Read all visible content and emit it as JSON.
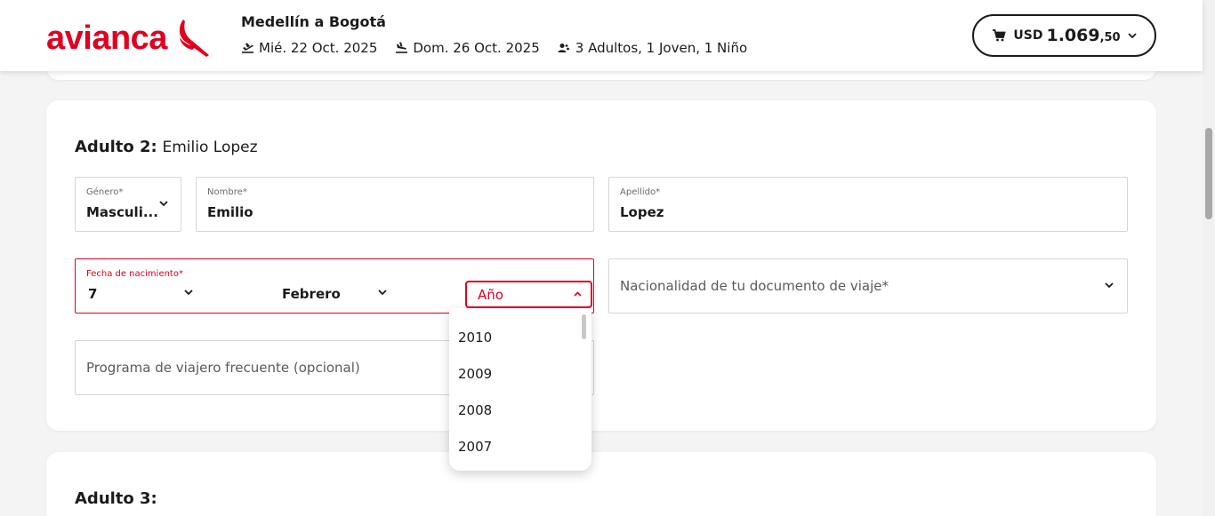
{
  "header": {
    "logo_text": "avianca",
    "route": "Medellín a Bogotá",
    "departure_date": "Mié. 22 Oct. 2025",
    "return_date": "Dom. 26 Oct. 2025",
    "passengers": "3 Adultos, 1 Joven, 1 Niño",
    "cart": {
      "currency": "USD",
      "amount": "1.069",
      "cents": ",50"
    }
  },
  "passenger2": {
    "title": "Adulto 2:",
    "name": "Emilio Lopez",
    "gender": {
      "label": "Género*",
      "value": "Masculi..."
    },
    "first_name": {
      "label": "Nombre*",
      "value": "Emilio"
    },
    "last_name": {
      "label": "Apellido*",
      "value": "Lopez"
    },
    "dob": {
      "label": "Fecha de nacimiento*",
      "day": "7",
      "month": "Febrero",
      "year_placeholder": "Año",
      "year_options": [
        "2010",
        "2009",
        "2008",
        "2007"
      ]
    },
    "nationality_placeholder": "Nacionalidad de tu documento de viaje*",
    "frequent_flyer_placeholder": "Programa de viajero frecuente (opcional)"
  },
  "passenger3": {
    "title": "Adulto 3:"
  },
  "colors": {
    "brand_red": "#e1001f",
    "text": "#1b1b1b",
    "border": "#d6d6d6"
  }
}
